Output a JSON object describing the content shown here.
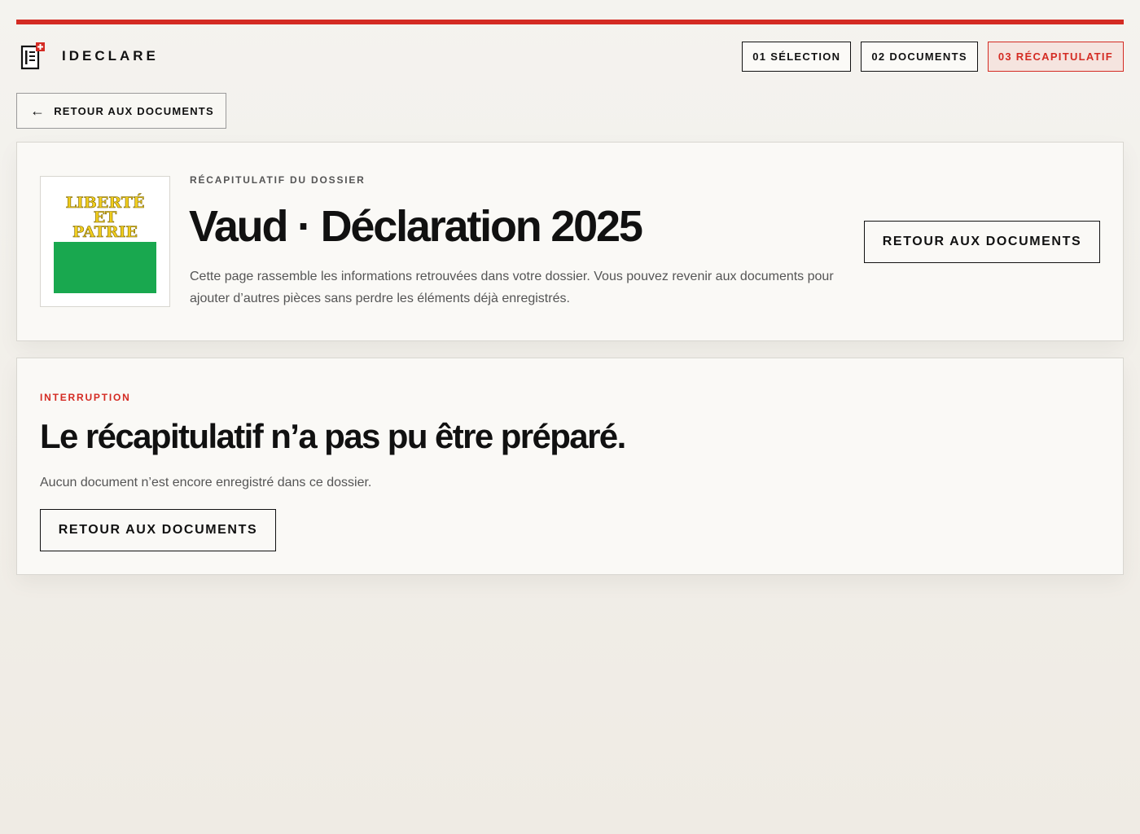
{
  "app": {
    "name": "IDECLARE"
  },
  "steps": [
    {
      "label": "01 SÉLECTION",
      "active": false
    },
    {
      "label": "02 DOCUMENTS",
      "active": false
    },
    {
      "label": "03 RÉCAPITULATIF",
      "active": true
    }
  ],
  "nav": {
    "back_label": "RETOUR AUX DOCUMENTS"
  },
  "summary": {
    "eyebrow": "RÉCAPITULATIF DU DOSSIER",
    "title": "Vaud · Déclaration 2025",
    "description": "Cette page rassemble les informations retrouvées dans votre dossier. Vous pouvez revenir aux documents pour ajouter d’autres pièces sans perdre les éléments déjà enregistrés.",
    "button_label": "RETOUR AUX DOCUMENTS",
    "flag": {
      "motto": [
        "LIBERTÉ",
        "ET",
        "PATRIE"
      ],
      "top_color": "#ffffff",
      "bottom_color": "#19a84f",
      "motto_color": "#f2cf1f"
    }
  },
  "interruption": {
    "eyebrow": "INTERRUPTION",
    "title": "Le récapitulatif n’a pas pu être préparé.",
    "message": "Aucun document n’est encore enregistré dans ce dossier.",
    "button_label": "RETOUR AUX DOCUMENTS"
  },
  "colors": {
    "accent": "#d42b23",
    "text": "#111111",
    "muted": "#555555"
  }
}
